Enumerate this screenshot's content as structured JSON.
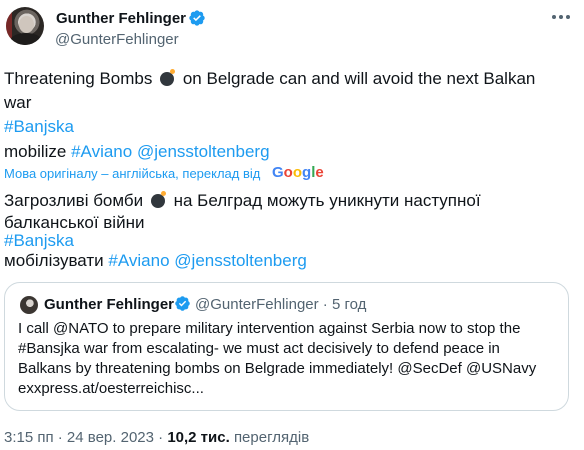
{
  "author": {
    "name": "Gunther Fehlinger",
    "handle": "@GunterFehlinger"
  },
  "tweet": {
    "line1_a": "Threatening Bombs",
    "line1_b": "on Belgrade can and will avoid the next Balkan",
    "line2": "war",
    "hashtag1": "#Banjska",
    "mobilize": "mobilize",
    "hashtag2": "#Aviano",
    "mention": "@jensstoltenberg"
  },
  "translation": {
    "label": "Мова оригіналу – англійська, переклад від",
    "provider": "Google",
    "line1_a": "Загрозливі бомби",
    "line1_b": "на Белград можуть уникнути наступної",
    "line2": "балканської війни",
    "hashtag1": "#Banjska",
    "mobilize": "мобілізувати",
    "hashtag2": "#Aviano",
    "mention": "@jensstoltenberg"
  },
  "quote": {
    "name": "Gunther Fehlinger",
    "handle_time": "@GunterFehlinger · 5 год",
    "line1": "I call @NATO to prepare military intervention against Serbia now to stop the",
    "line2": "#Bansjka war from escalating- we must act decisively to defend peace in",
    "line3": "Balkans by threatening bombs on Belgrade immediately! @SecDef @USNavy",
    "line4": "exxpress.at/oesterreichisc..."
  },
  "meta": {
    "timestamp": "3:15 пп · 24 вер. 2023 ·",
    "views_count": "10,2 тис.",
    "views_label": "переглядів"
  },
  "colors": {
    "link": "#1d9bf0",
    "verified": "#1d9bf0",
    "secondary_text": "#536471",
    "border": "#cfd9de"
  },
  "icons": [
    "verified-badge-icon",
    "more-options-icon",
    "bomb-emoji-icon",
    "google-logo"
  ]
}
